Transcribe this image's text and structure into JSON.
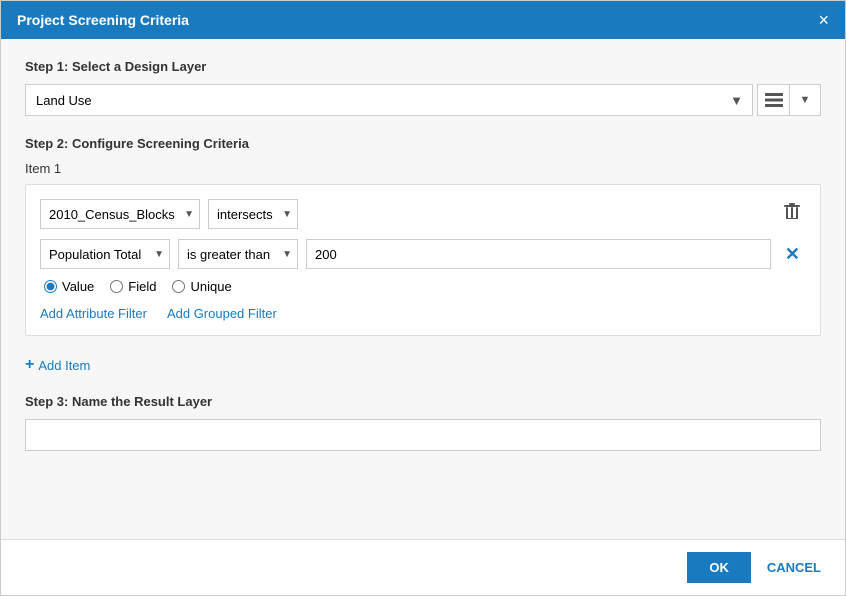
{
  "dialog": {
    "title": "Project Screening Criteria",
    "close_label": "×"
  },
  "step1": {
    "label": "Step 1: Select a Design Layer",
    "selected_layer": "Land Use",
    "layers": [
      "Land Use"
    ],
    "icons": {
      "layers_icon": "🗂",
      "chevron_icon": "▼"
    }
  },
  "step2": {
    "label": "Step 2: Configure Screening Criteria",
    "item_label": "Item",
    "item_number": "1",
    "filter_row1": {
      "field": "2010_Census_Blocks",
      "field_options": [
        "2010_Census_Blocks"
      ],
      "operator": "intersects",
      "operator_options": [
        "intersects"
      ]
    },
    "filter_row2": {
      "field": "Population Total",
      "field_options": [
        "Population Total"
      ],
      "operator": "is greater than",
      "operator_options": [
        "is greater than"
      ],
      "value": "200"
    },
    "radio_options": [
      {
        "id": "r-value",
        "label": "Value",
        "checked": true
      },
      {
        "id": "r-field",
        "label": "Field",
        "checked": false
      },
      {
        "id": "r-unique",
        "label": "Unique",
        "checked": false
      }
    ],
    "add_attribute_filter_label": "Add Attribute Filter",
    "add_grouped_filter_label": "Add Grouped Filter"
  },
  "add_item": {
    "label": "Add Item"
  },
  "step3": {
    "label": "Step 3: Name the Result Layer",
    "placeholder": ""
  },
  "footer": {
    "ok_label": "OK",
    "cancel_label": "CANCEL"
  }
}
